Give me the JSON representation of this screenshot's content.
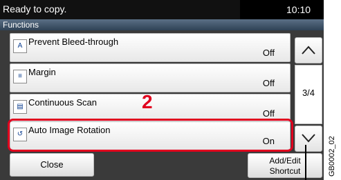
{
  "status": {
    "message": "Ready to copy.",
    "time": "10:10"
  },
  "section_title": "Functions",
  "items": [
    {
      "label": "Prevent Bleed-through",
      "value": "Off",
      "icon": "bleed-through-icon"
    },
    {
      "label": "Margin",
      "value": "Off",
      "icon": "margin-icon"
    },
    {
      "label": "Continuous Scan",
      "value": "Off",
      "icon": "continuous-scan-icon"
    },
    {
      "label": "Auto Image Rotation",
      "value": "On",
      "icon": "auto-rotation-icon"
    }
  ],
  "page_indicator": "3/4",
  "close_label": "Close",
  "add_edit_shortcut": {
    "line1": "Add/Edit",
    "line2": "Shortcut"
  },
  "callout_number": "2",
  "reference_code": "GB0002_02",
  "accent_color": "#e1001e"
}
